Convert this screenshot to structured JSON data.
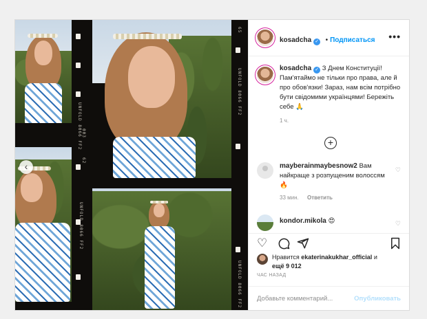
{
  "colors": {
    "accent": "#0095f6",
    "verified": "#3897f0",
    "muted": "#8e8e8e"
  },
  "media": {
    "film_labels": [
      "UNFOLD 8066 FF2",
      "UNFOLD 8066 FF2",
      "UNFOLD 8066 FF2",
      "UNFOLD 8066 FF2",
      "003",
      "65",
      "62"
    ],
    "prev_arrow": "‹"
  },
  "header": {
    "username": "kosadcha",
    "dot": "•",
    "follow_label": "Подписаться",
    "more_label": "•••"
  },
  "caption": {
    "username": "kosadcha",
    "text": "З Днем Конституції! Пам'ятаймо не тільки про права, але й про обов'язки! Зараз, нам всім потрібно бути свідомими українцями! Бережіть себе 🙏",
    "time": "1 ч."
  },
  "load_more_icon": "plus-circle-icon",
  "comments": [
    {
      "username": "mayberainmaybesnow2",
      "text": "Вам найкраще з розпущеним волоссям🔥",
      "time": "33 мин.",
      "reply_label": "Ответить"
    },
    {
      "username": "kondor.mikola",
      "text": "😍"
    }
  ],
  "likes": {
    "prefix": "Нравится",
    "liker": "ekaterinakukhar_official",
    "and": "и",
    "rest": "ещё 9 012"
  },
  "timestamp": "ЧАС НАЗАД",
  "add_comment": {
    "placeholder": "Добавьте комментарий...",
    "post_label": "Опубликовать"
  }
}
